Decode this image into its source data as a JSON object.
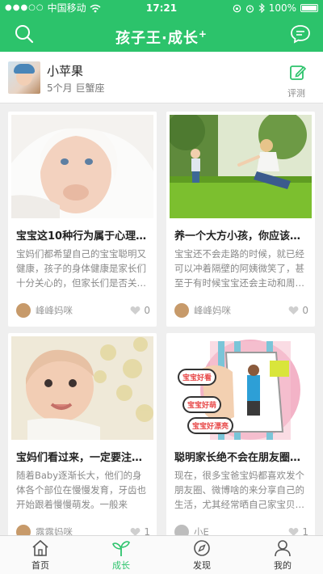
{
  "status": {
    "carrier": "中国移动",
    "time": "17:21",
    "battery": "100%"
  },
  "header": {
    "title": "孩子王·成长",
    "title_suffix": "+"
  },
  "profile": {
    "name": "小苹果",
    "info": "5个月 巨蟹座",
    "eval_label": "评测"
  },
  "cards": [
    {
      "title": "宝宝这10种行为属于心理问…",
      "desc": "宝妈们都希望自己的宝宝聪明又健康，孩子的身体健康是家长们十分关心的，但家长们是否关…",
      "author": "峰峰妈咪",
      "likes": "0"
    },
    {
      "title": "养一个大方小孩，你应该这…",
      "desc": "宝宝还不会走路的时候，就已经可以冲着隔壁的阿姨微笑了，甚至于有时候宝宝还会主动和周…",
      "author": "峰峰妈咪",
      "likes": "0"
    },
    {
      "title": "宝妈们看过来，一定要注意…",
      "desc": "随着Baby逐渐长大，他们的身体各个部位在慢慢发育，牙齿也开始跟着慢慢萌发。一般来说，…",
      "author": "露露妈咪",
      "likes": "1"
    },
    {
      "title": "聪明家长绝不会在朋友圈晒…",
      "desc": "现在，很多宝爸宝妈都喜欢发个朋友圈、微博啥的来分享自己的生活，尤其经常晒自己家宝贝…",
      "author": "小E",
      "likes": "1"
    }
  ],
  "poster_texts": [
    "宝宝好看",
    "宝宝好萌",
    "宝宝好漂亮"
  ],
  "tabs": [
    {
      "label": "首页",
      "icon": "home-icon",
      "active": false
    },
    {
      "label": "成长",
      "icon": "sprout-icon",
      "active": true
    },
    {
      "label": "发现",
      "icon": "compass-icon",
      "active": false
    },
    {
      "label": "我的",
      "icon": "person-icon",
      "active": false
    }
  ],
  "colors": {
    "accent": "#2cc36b"
  }
}
